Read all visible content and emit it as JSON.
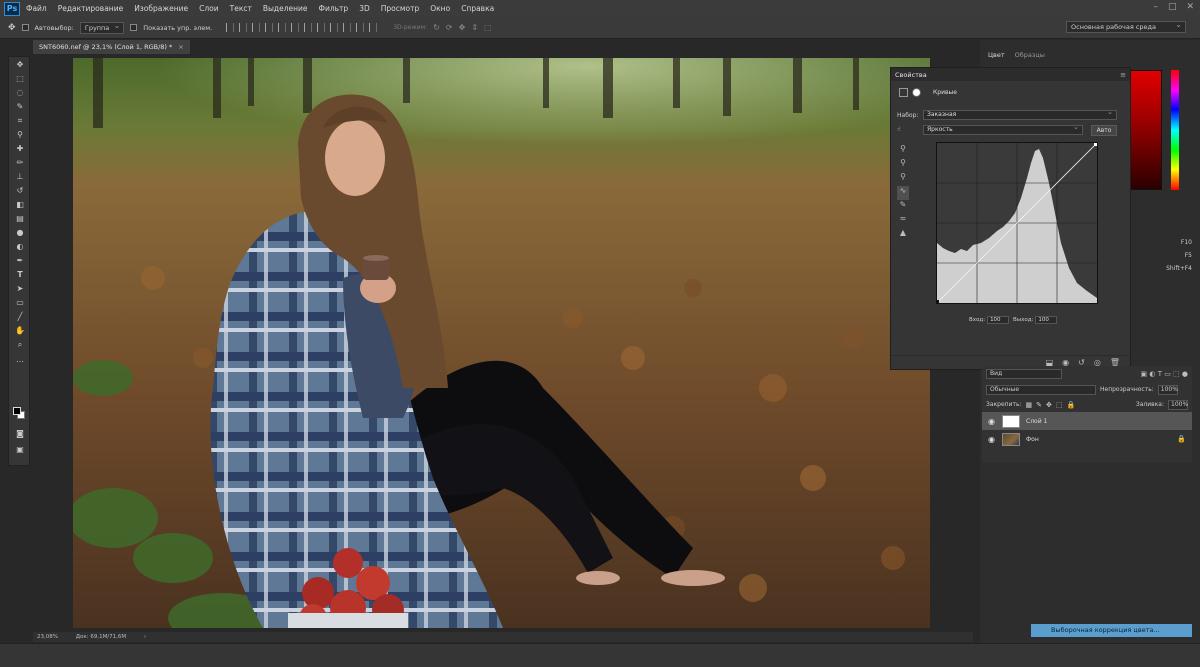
{
  "app": {
    "logo": "Ps"
  },
  "menu": [
    "Файл",
    "Редактирование",
    "Изображение",
    "Слои",
    "Текст",
    "Выделение",
    "Фильтр",
    "3D",
    "Просмотр",
    "Окно",
    "Справка"
  ],
  "options_bar": {
    "autoselect_label": "Автовыбор:",
    "autoselect_value": "Группа",
    "show_transform_label": "Показать упр. элем.",
    "mode_3d_label": "3D-режим:",
    "workspace": "Основная рабочая среда"
  },
  "document": {
    "tab_title": "SNT6060.nef @ 23,1% (Слой 1, RGB/8) *",
    "close_glyph": "×"
  },
  "status_bar": {
    "zoom": "23,08%",
    "doc_size": "Док: 69,1M/71,6M"
  },
  "color_panel": {
    "tabs": [
      "Цвет",
      "Образцы"
    ]
  },
  "shortcuts": [
    "F10",
    "F5",
    "Shift+F4"
  ],
  "properties": {
    "title": "Свойства",
    "menu_glyph": "≡",
    "subtitle": "Кривые",
    "preset_label": "Набор:",
    "preset_value": "Заказная",
    "channel_value": "Яркость",
    "auto_label": "Авто",
    "input_label": "Вход:",
    "input_value": "100",
    "output_label": "Выход:",
    "output_value": "100"
  },
  "layers": {
    "filter_kind": "Вид",
    "blend_mode": "Обычные",
    "opacity_label": "Непрозрачность:",
    "opacity_value": "100%",
    "lock_label": "Закрепить:",
    "fill_label": "Заливка:",
    "fill_value": "100%",
    "items": [
      {
        "name": "Слой 1",
        "active": true
      },
      {
        "name": "Фон",
        "active": false,
        "locked": true
      }
    ]
  },
  "tooltip": "Выборочная коррекция цвета..."
}
